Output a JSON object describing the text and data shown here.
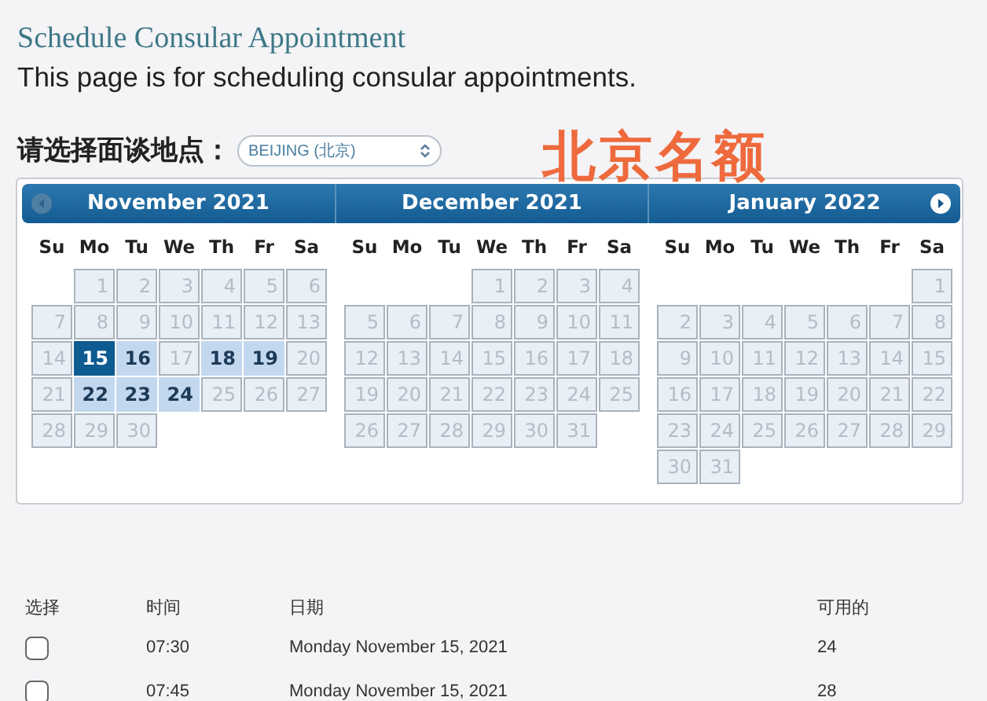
{
  "page": {
    "title": "Schedule Consular Appointment",
    "intro": "This page is for scheduling consular appointments."
  },
  "location": {
    "label": "请选择面谈地点：",
    "value": "BEIJING (北京)"
  },
  "annotation": "北京名额",
  "calendar": {
    "prev_disabled": true,
    "next_disabled": false,
    "months": [
      {
        "title": "November 2021",
        "weekdays": [
          "Su",
          "Mo",
          "Tu",
          "We",
          "Th",
          "Fr",
          "Sa"
        ],
        "weeks": [
          {
            "days": [
              {
                "day": "1",
                "available": false,
                "selected": false
              },
              {
                "day": "2",
                "available": false,
                "selected": false
              },
              {
                "day": "3",
                "available": false,
                "selected": false
              },
              {
                "day": "4",
                "available": false,
                "selected": false
              },
              {
                "day": "5",
                "available": false,
                "selected": false
              },
              {
                "day": "6",
                "available": false,
                "selected": false
              }
            ]
          },
          {
            "days": [
              {
                "day": "7",
                "available": false,
                "selected": false
              },
              {
                "day": "8",
                "available": false,
                "selected": false
              },
              {
                "day": "9",
                "available": false,
                "selected": false
              },
              {
                "day": "10",
                "available": false,
                "selected": false
              },
              {
                "day": "11",
                "available": false,
                "selected": false
              },
              {
                "day": "12",
                "available": false,
                "selected": false
              },
              {
                "day": "13",
                "available": false,
                "selected": false
              }
            ]
          },
          {
            "days": [
              {
                "day": "14",
                "available": false,
                "selected": false
              },
              {
                "day": "15",
                "available": true,
                "selected": true
              },
              {
                "day": "16",
                "available": true,
                "selected": false
              },
              {
                "day": "17",
                "available": false,
                "selected": false
              },
              {
                "day": "18",
                "available": true,
                "selected": false
              },
              {
                "day": "19",
                "available": true,
                "selected": false
              },
              {
                "day": "20",
                "available": false,
                "selected": false
              }
            ]
          },
          {
            "days": [
              {
                "day": "21",
                "available": false,
                "selected": false
              },
              {
                "day": "22",
                "available": true,
                "selected": false
              },
              {
                "day": "23",
                "available": true,
                "selected": false
              },
              {
                "day": "24",
                "available": true,
                "selected": false
              },
              {
                "day": "25",
                "available": false,
                "selected": false
              },
              {
                "day": "26",
                "available": false,
                "selected": false
              },
              {
                "day": "27",
                "available": false,
                "selected": false
              }
            ]
          },
          {
            "days": [
              {
                "day": "28",
                "available": false,
                "selected": false
              },
              {
                "day": "29",
                "available": false,
                "selected": false
              },
              {
                "day": "30",
                "available": false,
                "selected": false
              }
            ]
          }
        ]
      },
      {
        "title": "December 2021",
        "weekdays": [
          "Su",
          "Mo",
          "Tu",
          "We",
          "Th",
          "Fr",
          "Sa"
        ],
        "weeks": [
          {
            "days": [
              {
                "day": "1",
                "available": false,
                "selected": false
              },
              {
                "day": "2",
                "available": false,
                "selected": false
              },
              {
                "day": "3",
                "available": false,
                "selected": false
              },
              {
                "day": "4",
                "available": false,
                "selected": false
              }
            ]
          },
          {
            "days": [
              {
                "day": "5",
                "available": false,
                "selected": false
              },
              {
                "day": "6",
                "available": false,
                "selected": false
              },
              {
                "day": "7",
                "available": false,
                "selected": false
              },
              {
                "day": "8",
                "available": false,
                "selected": false
              },
              {
                "day": "9",
                "available": false,
                "selected": false
              },
              {
                "day": "10",
                "available": false,
                "selected": false
              },
              {
                "day": "11",
                "available": false,
                "selected": false
              }
            ]
          },
          {
            "days": [
              {
                "day": "12",
                "available": false,
                "selected": false
              },
              {
                "day": "13",
                "available": false,
                "selected": false
              },
              {
                "day": "14",
                "available": false,
                "selected": false
              },
              {
                "day": "15",
                "available": false,
                "selected": false
              },
              {
                "day": "16",
                "available": false,
                "selected": false
              },
              {
                "day": "17",
                "available": false,
                "selected": false
              },
              {
                "day": "18",
                "available": false,
                "selected": false
              }
            ]
          },
          {
            "days": [
              {
                "day": "19",
                "available": false,
                "selected": false
              },
              {
                "day": "20",
                "available": false,
                "selected": false
              },
              {
                "day": "21",
                "available": false,
                "selected": false
              },
              {
                "day": "22",
                "available": false,
                "selected": false
              },
              {
                "day": "23",
                "available": false,
                "selected": false
              },
              {
                "day": "24",
                "available": false,
                "selected": false
              },
              {
                "day": "25",
                "available": false,
                "selected": false
              }
            ]
          },
          {
            "days": [
              {
                "day": "26",
                "available": false,
                "selected": false
              },
              {
                "day": "27",
                "available": false,
                "selected": false
              },
              {
                "day": "28",
                "available": false,
                "selected": false
              },
              {
                "day": "29",
                "available": false,
                "selected": false
              },
              {
                "day": "30",
                "available": false,
                "selected": false
              },
              {
                "day": "31",
                "available": false,
                "selected": false
              }
            ]
          }
        ]
      },
      {
        "title": "January 2022",
        "weekdays": [
          "Su",
          "Mo",
          "Tu",
          "We",
          "Th",
          "Fr",
          "Sa"
        ],
        "weeks": [
          {
            "days": [
              {
                "day": "1",
                "available": false,
                "selected": false
              }
            ]
          },
          {
            "days": [
              {
                "day": "2",
                "available": false,
                "selected": false
              },
              {
                "day": "3",
                "available": false,
                "selected": false
              },
              {
                "day": "4",
                "available": false,
                "selected": false
              },
              {
                "day": "5",
                "available": false,
                "selected": false
              },
              {
                "day": "6",
                "available": false,
                "selected": false
              },
              {
                "day": "7",
                "available": false,
                "selected": false
              },
              {
                "day": "8",
                "available": false,
                "selected": false
              }
            ]
          },
          {
            "days": [
              {
                "day": "9",
                "available": false,
                "selected": false
              },
              {
                "day": "10",
                "available": false,
                "selected": false
              },
              {
                "day": "11",
                "available": false,
                "selected": false
              },
              {
                "day": "12",
                "available": false,
                "selected": false
              },
              {
                "day": "13",
                "available": false,
                "selected": false
              },
              {
                "day": "14",
                "available": false,
                "selected": false
              },
              {
                "day": "15",
                "available": false,
                "selected": false
              }
            ]
          },
          {
            "days": [
              {
                "day": "16",
                "available": false,
                "selected": false
              },
              {
                "day": "17",
                "available": false,
                "selected": false
              },
              {
                "day": "18",
                "available": false,
                "selected": false
              },
              {
                "day": "19",
                "available": false,
                "selected": false
              },
              {
                "day": "20",
                "available": false,
                "selected": false
              },
              {
                "day": "21",
                "available": false,
                "selected": false
              },
              {
                "day": "22",
                "available": false,
                "selected": false
              }
            ]
          },
          {
            "days": [
              {
                "day": "23",
                "available": false,
                "selected": false
              },
              {
                "day": "24",
                "available": false,
                "selected": false
              },
              {
                "day": "25",
                "available": false,
                "selected": false
              },
              {
                "day": "26",
                "available": false,
                "selected": false
              },
              {
                "day": "27",
                "available": false,
                "selected": false
              },
              {
                "day": "28",
                "available": false,
                "selected": false
              },
              {
                "day": "29",
                "available": false,
                "selected": false
              }
            ]
          },
          {
            "days": [
              {
                "day": "30",
                "available": false,
                "selected": false
              },
              {
                "day": "31",
                "available": false,
                "selected": false
              }
            ]
          }
        ]
      }
    ]
  },
  "table": {
    "columns": [
      "选择",
      "时间",
      "日期",
      "可用的"
    ],
    "rows": [
      {
        "checked": false,
        "time": "07:30",
        "date": "Monday November 15, 2021",
        "available": "24"
      },
      {
        "checked": false,
        "time": "07:45",
        "date": "Monday November 15, 2021",
        "available": "28"
      }
    ]
  }
}
